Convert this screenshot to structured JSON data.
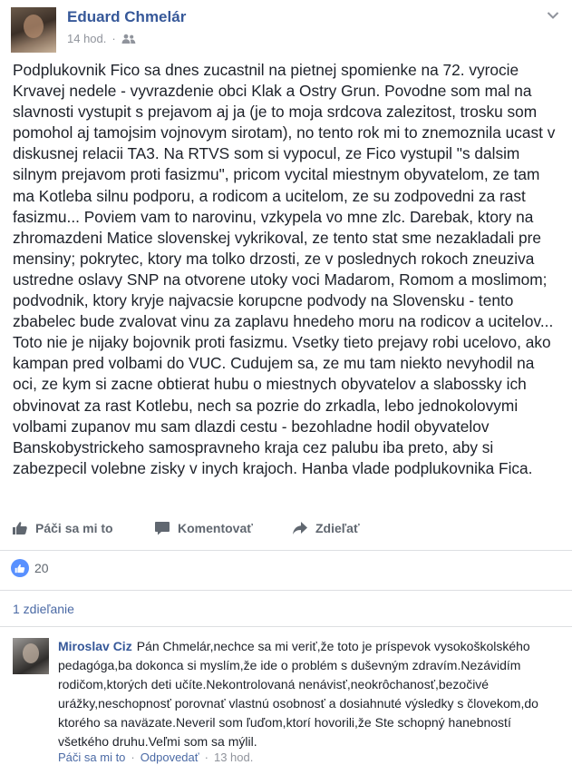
{
  "post": {
    "author": "Eduard Chmelár",
    "time": "14 hod.",
    "separator": "·",
    "text": "Podplukovnik Fico sa dnes zucastnil na pietnej spomienke na 72. vyrocie Krvavej nedele - vyvrazdenie obci Klak a Ostry Grun. Povodne som mal na slavnosti vystupit s prejavom aj ja (je to moja srdcova zalezitost, trosku som pomohol aj tamojsim vojnovym sirotam), no tento rok mi to znemoznila ucast v diskusnej relacii TA3. Na RTVS som si vypocul, ze Fico vystupil \"s dalsim silnym prejavom proti fasizmu\", pricom vycital miestnym obyvatelom, ze tam ma Kotleba silnu podporu, a rodicom a ucitelom, ze su zodpovedni za rast fasizmu... Poviem vam to narovinu, vzkypela vo mne zlc. Darebak, ktory na zhromazdeni Matice slovenskej vykrikoval, ze tento stat sme nezakladali pre mensiny; pokrytec, ktory ma tolko drzosti, ze v poslednych rokoch zneuziva ustredne oslavy SNP na otvorene utoky voci Madarom, Romom a moslimom; podvodnik, ktory kryje najvacsie korupcne podvody na Slovensku - tento zbabelec bude zvalovat vinu za zaplavu hnedeho moru na rodicov a ucitelov... Toto nie je nijaky bojovnik proti fasizmu. Vsetky tieto prejavy robi ucelovo, ako kampan pred volbami do VUC. Cudujem sa, ze mu tam niekto nevyhodil na oci, ze kym si zacne obtierat hubu o miestnych obyvatelov a slabossky ich obvinovat za rast Kotlebu, nech sa pozrie do zrkadla, lebo jednokolovymi volbami zupanov mu sam dlazdi cestu - bezohladne hodil obyvatelov Banskobystrickeho samospravneho kraja cez palubu iba preto, aby si zabezpecil volebne zisky v inych krajoch. Hanba vlade podplukovnika Fica."
  },
  "actions": {
    "like": "Páči sa mi to",
    "comment": "Komentovať",
    "share": "Zdieľať"
  },
  "reactions": {
    "count": "20"
  },
  "shares": {
    "label": "1 zdieľanie"
  },
  "comment": {
    "author": "Miroslav Ciz",
    "text": "Pán Chmelár,nechce sa mi veriť,že toto je príspevok vysokoškolského pedagóga,ba dokonca si myslím,že ide o problém s duševným zdravím.Nezávidím rodičom,ktorých deti učíte.Nekontrolovaná nenávisť,neokrôchanosť,bezočivé urážky,neschopnosť porovnať vlastnú osobnosť a dosiahnuté výsledky s človekom,do ktorého sa naväzate.Neveril som ľuďom,ktorí hovorili,že Ste schopný hanebností všetkého druhu.Veľmi som sa mýlil.",
    "like": "Páči sa mi to",
    "reply": "Odpovedať",
    "time": "13 hod.",
    "dot": "·"
  },
  "colors": {
    "link": "#365899",
    "secondary": "#90949c",
    "like_badge": "#5890ff"
  }
}
